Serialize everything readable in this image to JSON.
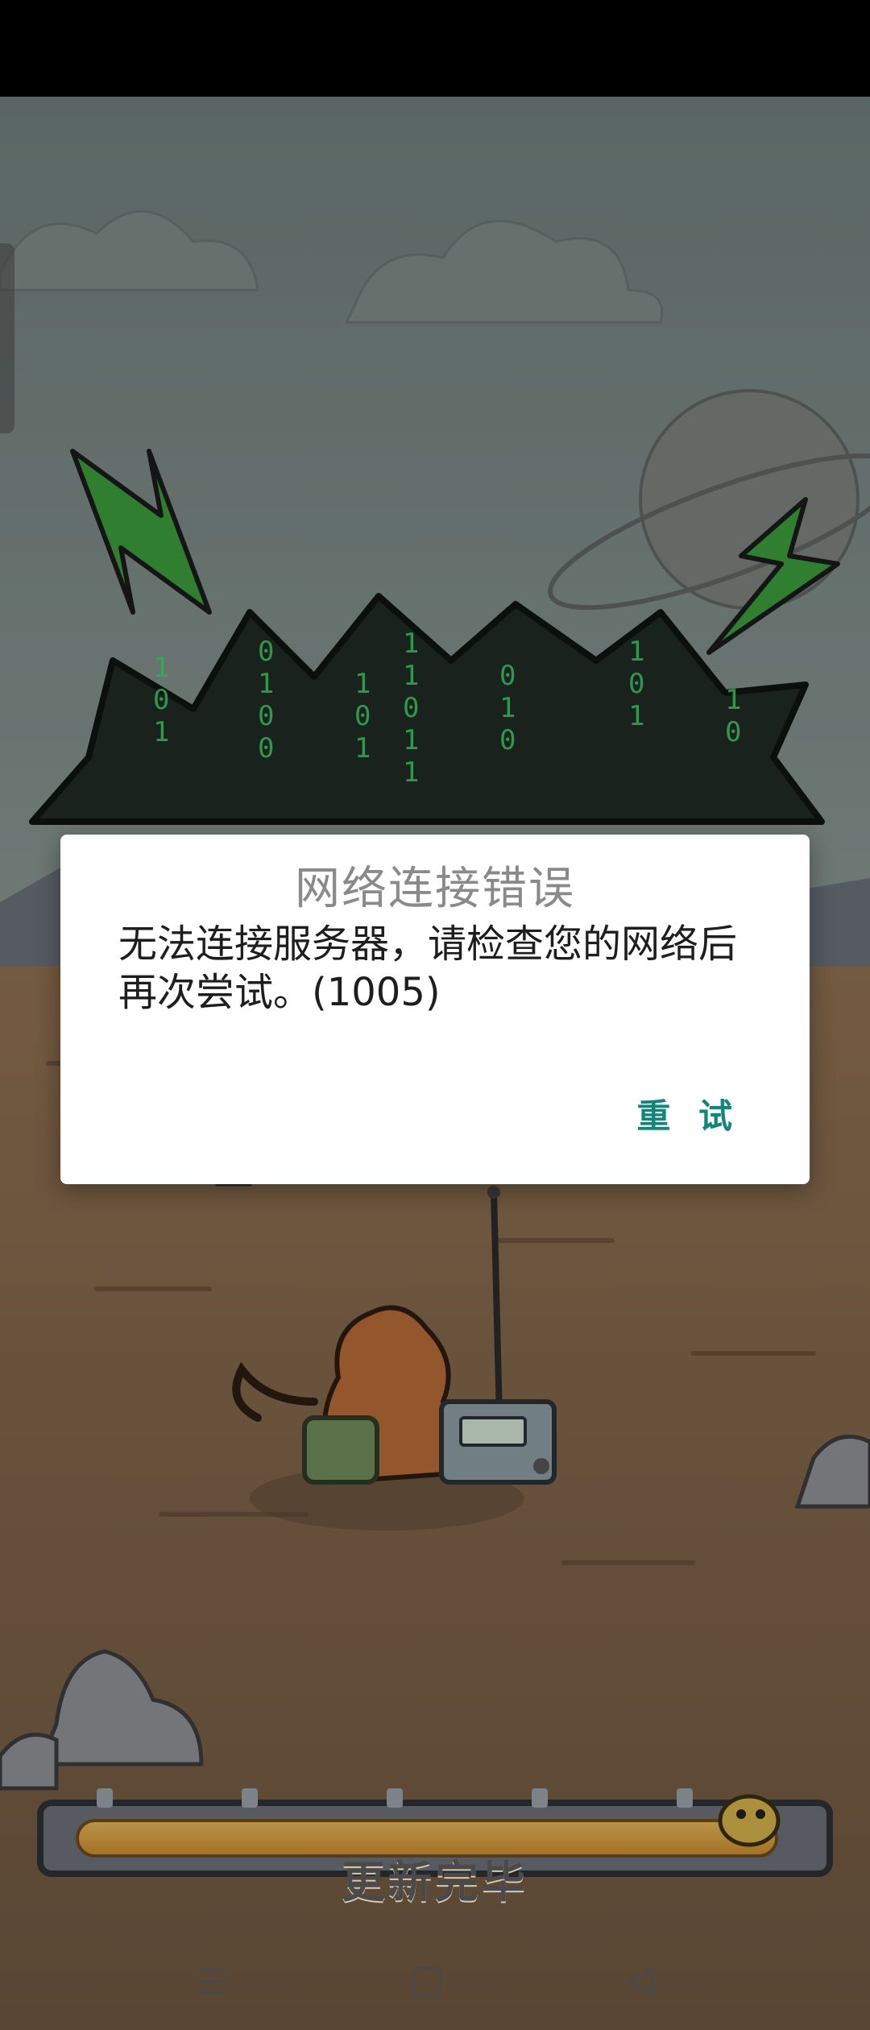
{
  "dialog": {
    "title": "网络连接错误",
    "message": "无法连接服务器，请检查您的网络后再次尝试。(1005)",
    "retry_label": "重 试"
  },
  "loading": {
    "status_label": "更新完毕",
    "progress": 1.0
  },
  "navigation": {
    "menu_icon": "menu-icon",
    "home_icon": "home-icon",
    "back_icon": "back-icon"
  },
  "colors": {
    "accent": "#13867b",
    "dialog_bg": "#ffffff",
    "matrix_green": "#3fd46a"
  }
}
